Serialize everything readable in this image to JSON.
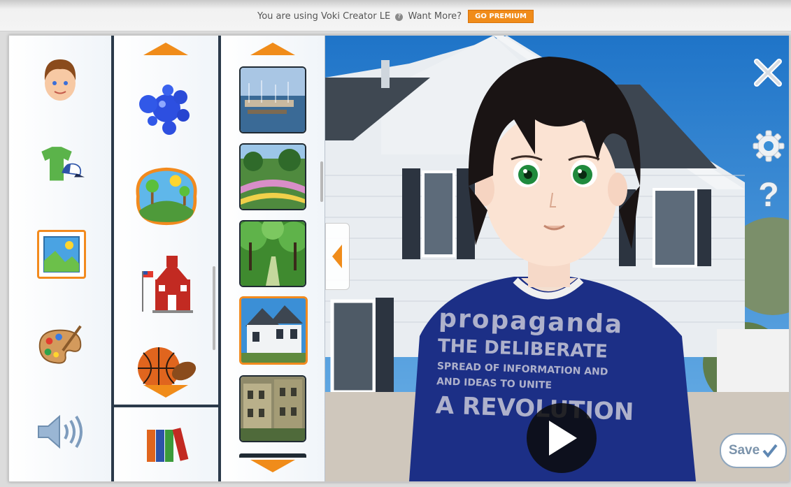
{
  "banner": {
    "text": "You are using Voki Creator LE",
    "want_more": "Want More?",
    "premium_label": "GO PREMIUM"
  },
  "categories": [
    {
      "name": "head",
      "icon": "boy-head-icon"
    },
    {
      "name": "clothing",
      "icon": "shirt-cap-icon"
    },
    {
      "name": "background",
      "icon": "landscape-picture-icon",
      "selected": true
    },
    {
      "name": "color",
      "icon": "paint-palette-icon"
    },
    {
      "name": "voice",
      "icon": "speaker-icon"
    }
  ],
  "subcategories": [
    {
      "icon": "bubbles-icon"
    },
    {
      "icon": "outdoor-scene-icon",
      "selected": true
    },
    {
      "icon": "schoolhouse-icon"
    },
    {
      "icon": "sports-balls-icon"
    },
    {
      "icon": "books-icon"
    }
  ],
  "backgrounds": [
    {
      "icon": "harbor-thumbnail"
    },
    {
      "icon": "garden-thumbnail"
    },
    {
      "icon": "forest-path-thumbnail"
    },
    {
      "icon": "white-house-thumbnail",
      "selected": true
    },
    {
      "icon": "old-buildings-thumbnail"
    }
  ],
  "stage": {
    "shirt_line1": "propaganda",
    "shirt_line2": "THE DELIBERATE",
    "shirt_line3": "SPREAD OF INFORMATION AND",
    "shirt_line4": "AND IDEAS TO UNITE",
    "shirt_line5": "A REVOLUTION"
  },
  "buttons": {
    "save_label": "Save",
    "help_label": "?"
  },
  "colors": {
    "accent": "#f08c1a",
    "divider": "#2b3a4a",
    "sky": "#3b8fd6"
  }
}
